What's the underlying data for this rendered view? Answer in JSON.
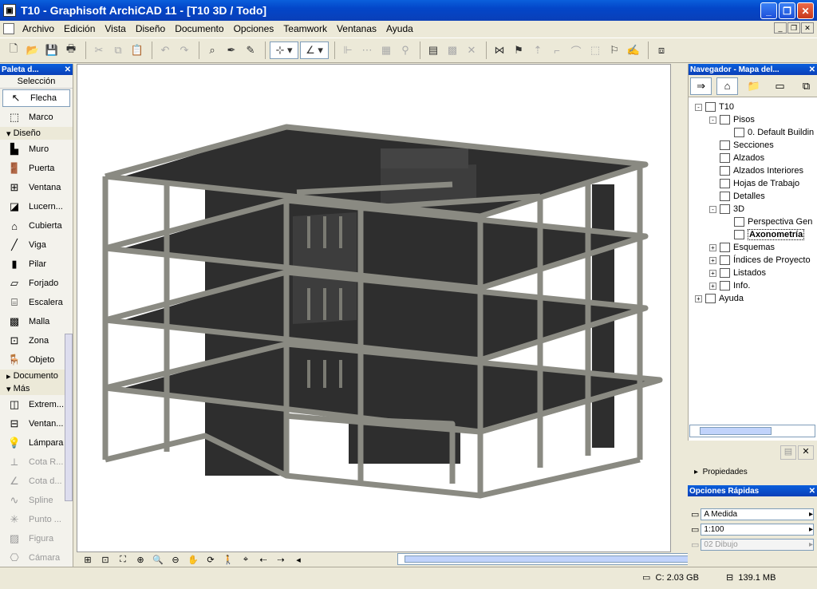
{
  "window": {
    "title": "T10 - Graphisoft ArchiCAD 11 - [T10 3D / Todo]"
  },
  "menu": [
    "Archivo",
    "Edición",
    "Vista",
    "Diseño",
    "Documento",
    "Opciones",
    "Teamwork",
    "Ventanas",
    "Ayuda"
  ],
  "palette": {
    "title": "Paleta d...",
    "selection_label": "Selección",
    "selection_tools": [
      {
        "label": "Flecha",
        "icon": "arrow-icon"
      },
      {
        "label": "Marco",
        "icon": "marquee-icon"
      }
    ],
    "design_label": "Diseño",
    "design_tools": [
      {
        "label": "Muro",
        "icon": "wall-icon"
      },
      {
        "label": "Puerta",
        "icon": "door-icon"
      },
      {
        "label": "Ventana",
        "icon": "window-icon"
      },
      {
        "label": "Lucern...",
        "icon": "skylight-icon"
      },
      {
        "label": "Cubierta",
        "icon": "roof-icon"
      },
      {
        "label": "Viga",
        "icon": "beam-icon"
      },
      {
        "label": "Pilar",
        "icon": "column-icon"
      },
      {
        "label": "Forjado",
        "icon": "slab-icon"
      },
      {
        "label": "Escalera",
        "icon": "stair-icon"
      },
      {
        "label": "Malla",
        "icon": "mesh-icon"
      },
      {
        "label": "Zona",
        "icon": "zone-icon"
      },
      {
        "label": "Objeto",
        "icon": "object-icon"
      }
    ],
    "document_label": "Documento",
    "more_label": "Más",
    "more_tools": [
      {
        "label": "Extrem...",
        "icon": "extrude-icon"
      },
      {
        "label": "Ventan...",
        "icon": "corner-window-icon"
      },
      {
        "label": "Lámpara",
        "icon": "lamp-icon"
      },
      {
        "label": "Cota R...",
        "icon": "level-dim-icon"
      },
      {
        "label": "Cota d...",
        "icon": "angle-dim-icon"
      },
      {
        "label": "Spline",
        "icon": "spline-icon"
      },
      {
        "label": "Punto ...",
        "icon": "hotspot-icon"
      },
      {
        "label": "Figura",
        "icon": "figure-icon"
      },
      {
        "label": "Cámara",
        "icon": "camera-icon"
      }
    ]
  },
  "navigator": {
    "title": "Navegador - Mapa del...",
    "tree": [
      {
        "label": "T10",
        "level": 0,
        "exp": "-",
        "icon": "house"
      },
      {
        "label": "Pisos",
        "level": 1,
        "exp": "-",
        "icon": "stories"
      },
      {
        "label": "0. Default Buildin",
        "level": 2,
        "exp": "",
        "icon": "story"
      },
      {
        "label": "Secciones",
        "level": 1,
        "exp": "",
        "icon": "section"
      },
      {
        "label": "Alzados",
        "level": 1,
        "exp": "",
        "icon": "elevation"
      },
      {
        "label": "Alzados Interiores",
        "level": 1,
        "exp": "",
        "icon": "interior"
      },
      {
        "label": "Hojas de Trabajo",
        "level": 1,
        "exp": "",
        "icon": "worksheet"
      },
      {
        "label": "Detalles",
        "level": 1,
        "exp": "",
        "icon": "detail"
      },
      {
        "label": "3D",
        "level": 1,
        "exp": "-",
        "icon": "3d"
      },
      {
        "label": "Perspectiva Gen",
        "level": 2,
        "exp": "",
        "icon": "perspective"
      },
      {
        "label": "Axonometría",
        "level": 2,
        "exp": "",
        "icon": "axon",
        "selected": true
      },
      {
        "label": "Esquemas",
        "level": 1,
        "exp": "+",
        "icon": "schedule"
      },
      {
        "label": "Índices de Proyecto",
        "level": 1,
        "exp": "+",
        "icon": "index"
      },
      {
        "label": "Listados",
        "level": 1,
        "exp": "+",
        "icon": "list"
      },
      {
        "label": "Info.",
        "level": 1,
        "exp": "+",
        "icon": "info"
      },
      {
        "label": "Ayuda",
        "level": 0,
        "exp": "+",
        "icon": "help"
      }
    ],
    "properties_label": "Propiedades"
  },
  "quick_options": {
    "title": "Opciones Rápidas",
    "items": [
      {
        "value": "A Medida",
        "enabled": true
      },
      {
        "value": "1:100",
        "enabled": true
      },
      {
        "value": "02 Dibujo",
        "enabled": false
      }
    ]
  },
  "status": {
    "disk": "C: 2.03 GB",
    "memory": "139.1 MB"
  }
}
